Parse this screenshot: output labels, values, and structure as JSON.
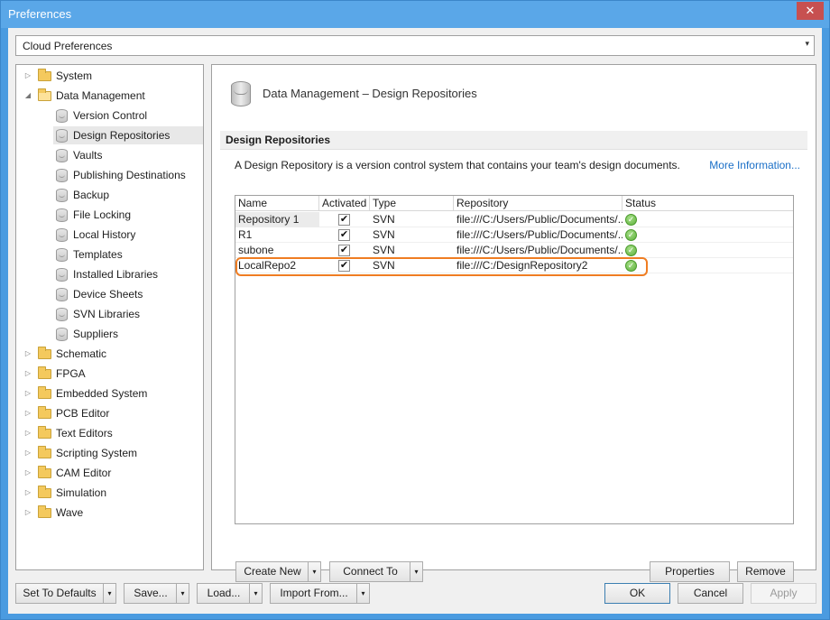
{
  "window": {
    "title": "Preferences",
    "close_glyph": "✕"
  },
  "profile": {
    "selected": "Cloud Preferences"
  },
  "tree": {
    "items": [
      {
        "label": "System",
        "level": 0,
        "expanded": false
      },
      {
        "label": "Data Management",
        "level": 0,
        "expanded": true
      },
      {
        "label": "Version Control",
        "level": 1
      },
      {
        "label": "Design Repositories",
        "level": 1,
        "selected": true
      },
      {
        "label": "Vaults",
        "level": 1
      },
      {
        "label": "Publishing Destinations",
        "level": 1
      },
      {
        "label": "Backup",
        "level": 1
      },
      {
        "label": "File Locking",
        "level": 1
      },
      {
        "label": "Local History",
        "level": 1
      },
      {
        "label": "Templates",
        "level": 1
      },
      {
        "label": "Installed Libraries",
        "level": 1
      },
      {
        "label": "Device Sheets",
        "level": 1
      },
      {
        "label": "SVN Libraries",
        "level": 1
      },
      {
        "label": "Suppliers",
        "level": 1
      },
      {
        "label": "Schematic",
        "level": 0,
        "expanded": false
      },
      {
        "label": "FPGA",
        "level": 0,
        "expanded": false
      },
      {
        "label": "Embedded System",
        "level": 0,
        "expanded": false
      },
      {
        "label": "PCB Editor",
        "level": 0,
        "expanded": false
      },
      {
        "label": "Text Editors",
        "level": 0,
        "expanded": false
      },
      {
        "label": "Scripting System",
        "level": 0,
        "expanded": false
      },
      {
        "label": "CAM Editor",
        "level": 0,
        "expanded": false
      },
      {
        "label": "Simulation",
        "level": 0,
        "expanded": false
      },
      {
        "label": "Wave",
        "level": 0,
        "expanded": false
      }
    ]
  },
  "content": {
    "header_title": "Data Management – Design Repositories",
    "section_title": "Design Repositories",
    "description": "A Design Repository is a version control system that contains your team's design documents.",
    "more_info": "More Information...",
    "columns": [
      "Name",
      "Activated",
      "Type",
      "Repository",
      "Status"
    ],
    "rows": [
      {
        "name": "Repository 1",
        "activated": true,
        "type": "SVN",
        "repository": "file:///C:/Users/Public/Documents/...",
        "status": "ok"
      },
      {
        "name": "R1",
        "activated": true,
        "type": "SVN",
        "repository": "file:///C:/Users/Public/Documents/...",
        "status": "ok"
      },
      {
        "name": "subone",
        "activated": true,
        "type": "SVN",
        "repository": "file:///C:/Users/Public/Documents/...",
        "status": "ok"
      },
      {
        "name": "LocalRepo2",
        "activated": true,
        "type": "SVN",
        "repository": "file:///C:/DesignRepository2",
        "status": "ok"
      }
    ],
    "highlight_color": "#ef7d22",
    "buttons": {
      "create_new": "Create New",
      "connect_to": "Connect To",
      "properties": "Properties",
      "remove": "Remove"
    }
  },
  "footer": {
    "set_to_defaults": "Set To Defaults",
    "save": "Save...",
    "load": "Load...",
    "import_from": "Import From...",
    "ok": "OK",
    "cancel": "Cancel",
    "apply": "Apply"
  },
  "glyphs": {
    "collapsed_arrow": "▷",
    "expanded_arrow": "◢",
    "dropdown_arrow": "▾",
    "check": "✔",
    "status_ok": "✓"
  },
  "colors": {
    "title_bar": "#5aa7e8",
    "link": "#1a6fc7",
    "status_ok": "#5cb03a"
  }
}
